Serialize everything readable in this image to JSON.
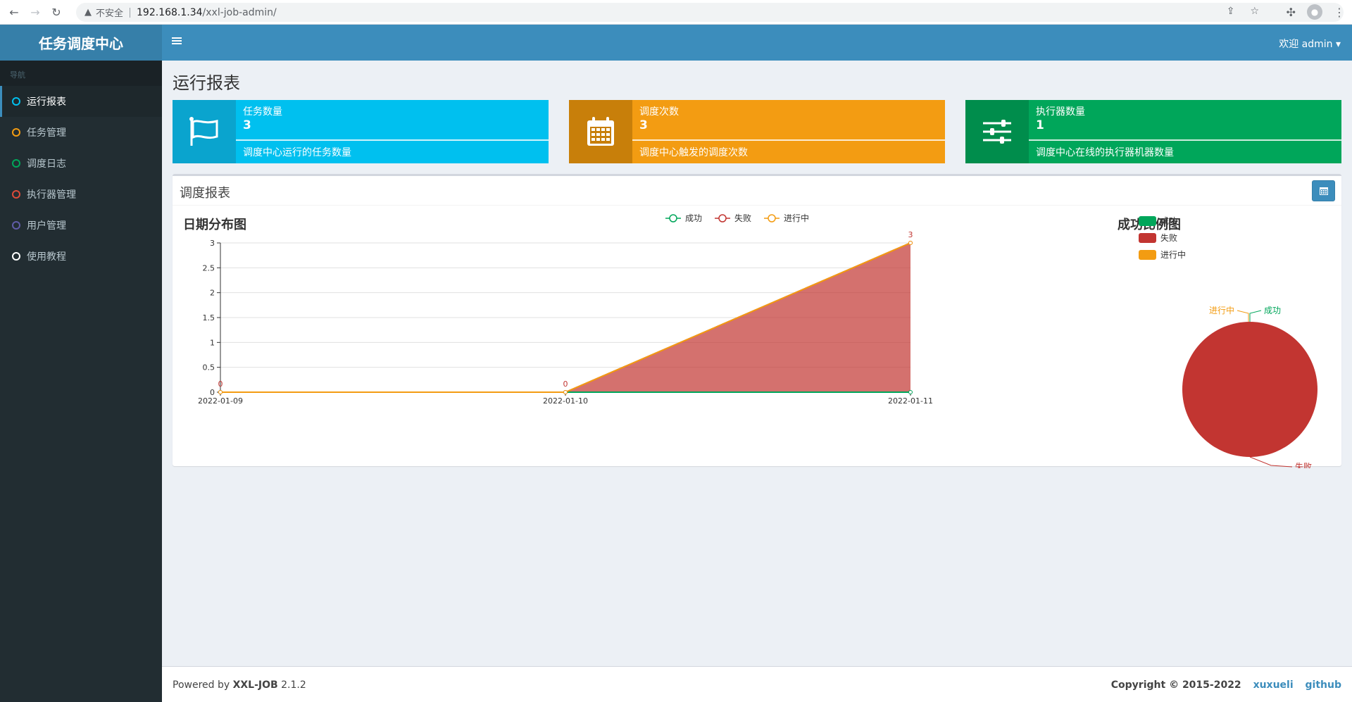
{
  "browser": {
    "insecure_label": "不安全",
    "url_host": "192.168.1.34",
    "url_path": "/xxl-job-admin/"
  },
  "app": {
    "logo": "任务调度中心",
    "user_menu": "欢迎 admin ▾"
  },
  "sidebar": {
    "header": "导航",
    "items": [
      {
        "label": "运行报表",
        "color": "#00c0ef"
      },
      {
        "label": "任务管理",
        "color": "#f39c12"
      },
      {
        "label": "调度日志",
        "color": "#00a65a"
      },
      {
        "label": "执行器管理",
        "color": "#dd4b39"
      },
      {
        "label": "用户管理",
        "color": "#605ca8"
      },
      {
        "label": "使用教程",
        "color": "#ffffff"
      }
    ]
  },
  "page": {
    "title": "运行报表"
  },
  "infoboxes": [
    {
      "label": "任务数量",
      "value": "3",
      "desc": "调度中心运行的任务数量",
      "color": "#00c0ef",
      "icon_bg": "#0aa4ce",
      "icon": "flag-icon"
    },
    {
      "label": "调度次数",
      "value": "3",
      "desc": "调度中心触发的调度次数",
      "color": "#f39c12",
      "icon_bg": "#c87f0a",
      "icon": "calendar-icon"
    },
    {
      "label": "执行器数量",
      "value": "1",
      "desc": "调度中心在线的执行器机器数量",
      "color": "#00a65a",
      "icon_bg": "#008d4c",
      "icon": "sliders-icon"
    }
  ],
  "report": {
    "panel_title": "调度报表",
    "line_title": "日期分布图",
    "pie_title": "成功比例图"
  },
  "chart_data": [
    {
      "type": "area",
      "title": "日期分布图",
      "categories": [
        "2022-01-09",
        "2022-01-10",
        "2022-01-11"
      ],
      "ylim": [
        0,
        3
      ],
      "yticks": [
        "0",
        "0.5",
        "1",
        "1.5",
        "2",
        "2.5",
        "3"
      ],
      "legend": "top",
      "grid": true,
      "series": [
        {
          "name": "成功",
          "values": [
            0,
            0,
            0
          ],
          "color": "#00a65a"
        },
        {
          "name": "失败",
          "values": [
            0,
            0,
            3
          ],
          "color": "#c23531"
        },
        {
          "name": "进行中",
          "values": [
            0,
            0,
            3
          ],
          "color": "#f39c12"
        }
      ],
      "data_labels": [
        "0",
        "0",
        "3"
      ]
    },
    {
      "type": "pie",
      "title": "成功比例图",
      "legend": "top-left",
      "slices": [
        {
          "name": "成功",
          "value": 0,
          "color": "#00a65a"
        },
        {
          "name": "失败",
          "value": 3,
          "color": "#c23531"
        },
        {
          "name": "进行中",
          "value": 0,
          "color": "#f39c12"
        }
      ]
    }
  ],
  "footer": {
    "powered_prefix": "Powered by ",
    "powered_name": "XXL-JOB",
    "version": " 2.1.2",
    "copyright": "Copyright © 2015-2022",
    "link1": "xuxueli",
    "link2": "github"
  }
}
